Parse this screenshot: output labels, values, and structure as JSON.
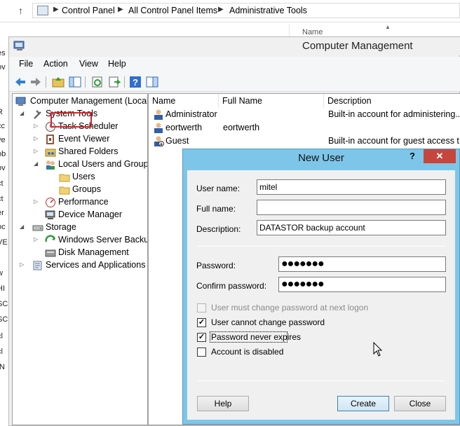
{
  "explorer": {
    "breadcrumb": [
      "Control Panel",
      "All Control Panel Items",
      "Administrative Tools"
    ],
    "bg_column_header": "Name"
  },
  "window": {
    "title": "Computer Management",
    "menu": [
      "File",
      "Action",
      "View",
      "Help"
    ]
  },
  "tree": {
    "root": "Computer Management (Local",
    "system_tools": "System Tools",
    "task_scheduler": "Task Scheduler",
    "event_viewer": "Event Viewer",
    "shared_folders": "Shared Folders",
    "local_users_groups": "Local Users and Groups",
    "users": "Users",
    "groups": "Groups",
    "performance": "Performance",
    "device_manager": "Device Manager",
    "storage": "Storage",
    "windows_server_backup": "Windows Server Backup",
    "disk_management": "Disk Management",
    "services_apps": "Services and Applications"
  },
  "list": {
    "columns": {
      "name": "Name",
      "full_name": "Full Name",
      "description": "Description"
    },
    "rows": [
      {
        "name": "Administrator",
        "full_name": "",
        "description": "Built-in account for administering..."
      },
      {
        "name": "eortwerth",
        "full_name": "eortwerth",
        "description": ""
      },
      {
        "name": "Guest",
        "full_name": "",
        "description": "Built-in account for guest access t..."
      }
    ]
  },
  "dialog": {
    "title": "New User",
    "help_glyph": "?",
    "close_glyph": "✕",
    "user_name_label": "User name:",
    "user_name_value": "mitel",
    "full_name_label": "Full name:",
    "full_name_value": "",
    "description_label": "Description:",
    "description_value": "DATASTOR backup account",
    "password_label": "Password:",
    "password_value": "●●●●●●●",
    "confirm_label": "Confirm password:",
    "confirm_value": "●●●●●●●",
    "chk_must_change": "User must change password at next logon",
    "chk_cannot_change": "User cannot change password",
    "chk_never_expires": "Password never expires",
    "chk_disabled": "Account is disabled",
    "checked": {
      "must_change": false,
      "cannot_change": true,
      "never_expires": true,
      "disabled": false
    },
    "help_button": "Help",
    "create_button": "Create",
    "close_button": "Close"
  }
}
